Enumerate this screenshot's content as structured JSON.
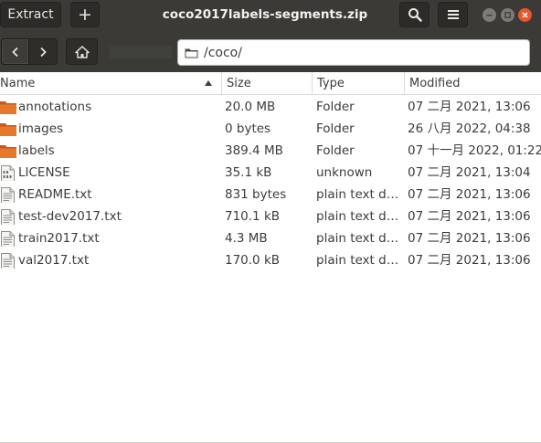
{
  "header": {
    "extract_label": "Extract",
    "add_label": "+",
    "title": "coco2017labels-segments.zip"
  },
  "toolbar": {
    "location": "/coco/"
  },
  "columns": {
    "name": "Name",
    "size": "Size",
    "type": "Type",
    "modified": "Modified"
  },
  "files": [
    {
      "name": "annotations",
      "size": "20.0 MB",
      "type": "Folder",
      "modified": "07 二月 2021, 13:06",
      "icon": "folder-icon"
    },
    {
      "name": "images",
      "size": "0 bytes",
      "type": "Folder",
      "modified": "26 八月 2022, 04:38",
      "icon": "folder-icon"
    },
    {
      "name": "labels",
      "size": "389.4 MB",
      "type": "Folder",
      "modified": "07 十一月 2022, 01:22",
      "icon": "folder-icon"
    },
    {
      "name": "LICENSE",
      "size": "35.1 kB",
      "type": "unknown",
      "modified": "07 二月 2021, 13:04",
      "icon": "binary-file-icon"
    },
    {
      "name": "README.txt",
      "size": "831 bytes",
      "type": "plain text d…",
      "modified": "07 二月 2021, 13:06",
      "icon": "text-file-icon"
    },
    {
      "name": "test-dev2017.txt",
      "size": "710.1 kB",
      "type": "plain text d…",
      "modified": "07 二月 2021, 13:06",
      "icon": "text-file-icon"
    },
    {
      "name": "train2017.txt",
      "size": "4.3 MB",
      "type": "plain text d…",
      "modified": "07 二月 2021, 13:06",
      "icon": "text-file-icon"
    },
    {
      "name": "val2017.txt",
      "size": "170.0 kB",
      "type": "plain text d…",
      "modified": "07 二月 2021, 13:06",
      "icon": "text-file-icon"
    }
  ],
  "colors": {
    "headerbar": "#3b3a36",
    "close_button": "#e8572c",
    "folder_orange": "#e5782c"
  }
}
